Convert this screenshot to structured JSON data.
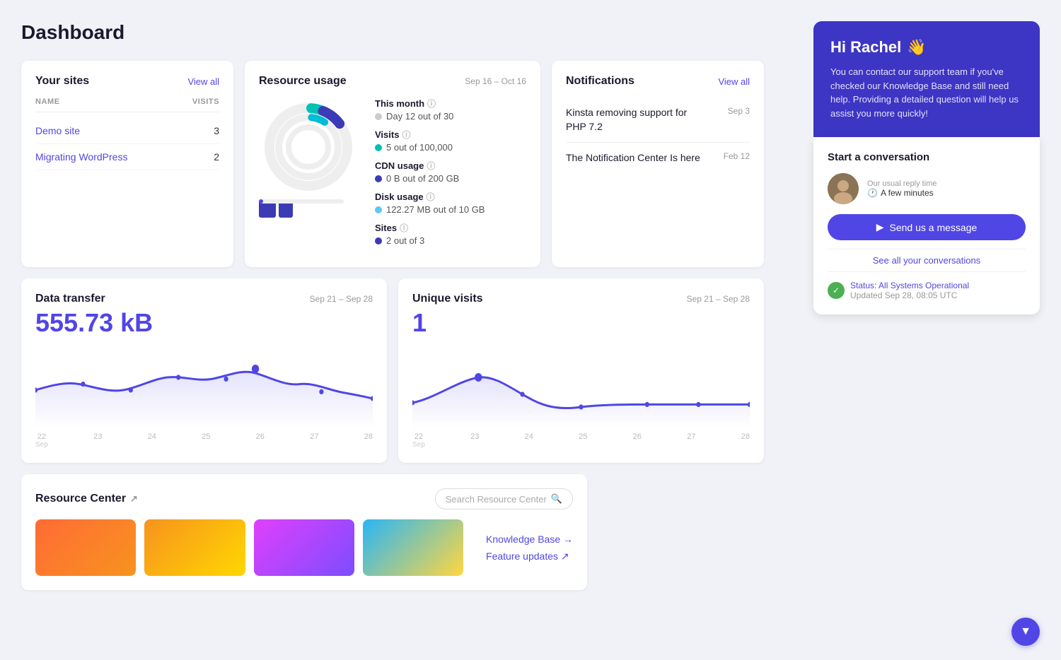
{
  "page": {
    "title": "Dashboard"
  },
  "your_sites": {
    "title": "Your sites",
    "view_all": "View all",
    "columns": {
      "name": "NAME",
      "visits": "VISITS"
    },
    "sites": [
      {
        "name": "Demo site",
        "visits": 3
      },
      {
        "name": "Migrating WordPress",
        "visits": 2
      }
    ]
  },
  "resource_usage": {
    "title": "Resource usage",
    "date_range": "Sep 16 – Oct 16",
    "this_month": {
      "label": "This month",
      "value": "Day 12 out of 30"
    },
    "visits": {
      "label": "Visits",
      "value": "5 out of 100,000"
    },
    "cdn_usage": {
      "label": "CDN usage",
      "value": "0 B out of 200 GB"
    },
    "disk_usage": {
      "label": "Disk usage",
      "value": "122.27 MB out of 10 GB"
    },
    "sites": {
      "label": "Sites",
      "value": "2 out of 3"
    }
  },
  "notifications": {
    "title": "Notifications",
    "view_all": "View all",
    "items": [
      {
        "text": "Kinsta removing support for PHP 7.2",
        "date": "Sep 3"
      },
      {
        "text": "The Notification Center Is here",
        "date": "Feb 12"
      }
    ]
  },
  "data_transfer": {
    "title": "Data transfer",
    "date_range": "Sep 21 – Sep 28",
    "value": "555.73 kB",
    "axis_labels": [
      "22",
      "23",
      "24",
      "25",
      "26",
      "27",
      "28"
    ],
    "axis_sub": "Sep"
  },
  "unique_visits": {
    "title": "Unique visits",
    "date_range": "Sep 21 – Sep 28",
    "value": "1",
    "axis_labels": [
      "22",
      "23",
      "24",
      "25",
      "26",
      "27",
      "28"
    ],
    "axis_sub": "Sep"
  },
  "resource_center": {
    "title": "Resource Center",
    "search_placeholder": "Search Resource Center",
    "links": [
      {
        "label": "Knowledge Base →"
      },
      {
        "label": "Feature updates ↗"
      }
    ]
  },
  "support": {
    "greeting": "Hi Rachel",
    "wave": "👋",
    "description": "You can contact our support team if you've checked our Knowledge Base and still need help. Providing a detailed question will help us assist you more quickly!",
    "start_conversation": "Start a conversation",
    "reply_label": "Our usual reply time",
    "reply_time": "A few minutes",
    "send_button": "Send us a message",
    "see_conversations": "See all your conversations",
    "status_text": "Status: All Systems Operational",
    "status_updated": "Updated Sep 28, 08:05 UTC"
  }
}
